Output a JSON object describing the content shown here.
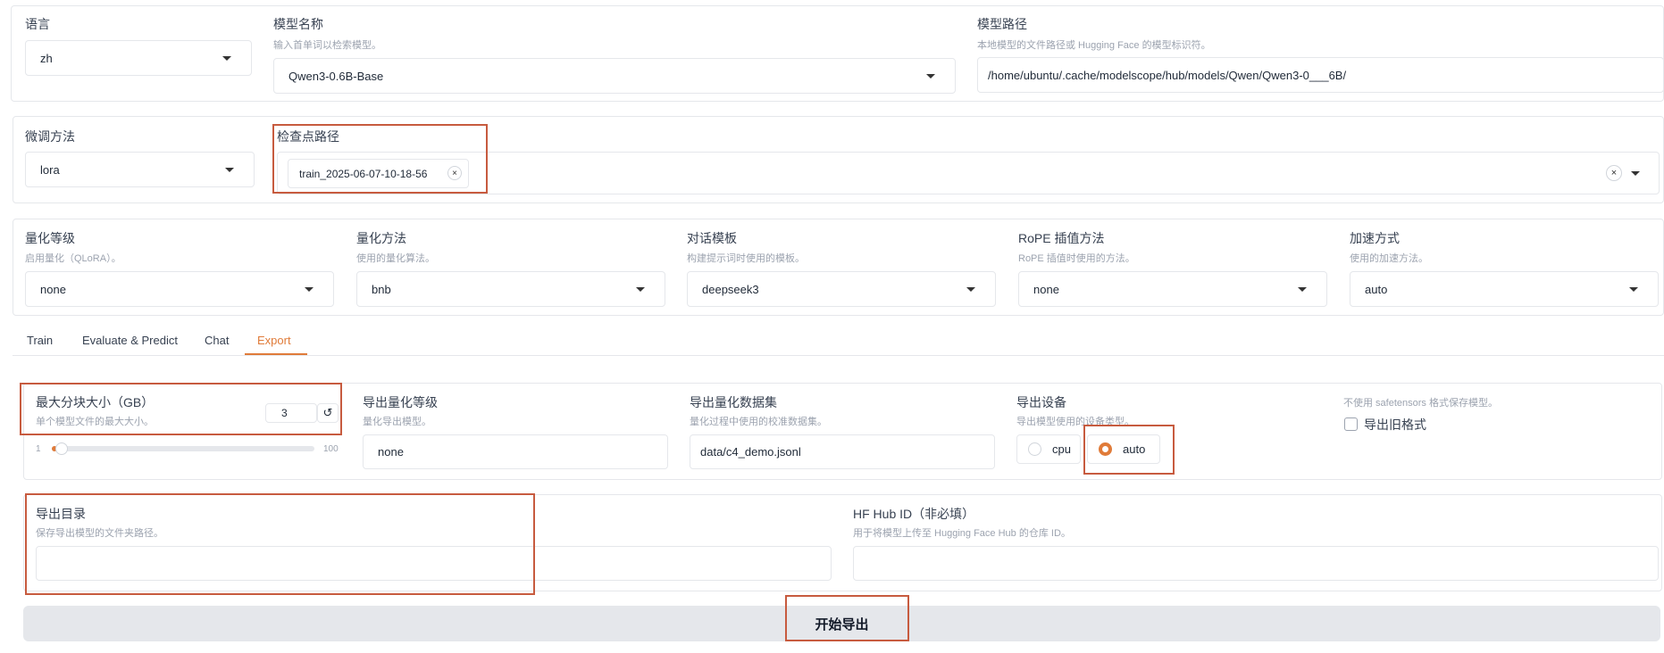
{
  "top": {
    "lang": {
      "label": "语言",
      "value": "zh"
    },
    "model_name": {
      "label": "模型名称",
      "hint": "输入首单词以检索模型。",
      "value": "Qwen3-0.6B-Base"
    },
    "model_path": {
      "label": "模型路径",
      "hint": "本地模型的文件路径或 Hugging Face 的模型标识符。",
      "value": "/home/ubuntu/.cache/modelscope/hub/models/Qwen/Qwen3-0___6B/"
    }
  },
  "finetune": {
    "method": {
      "label": "微调方法",
      "value": "lora"
    },
    "checkpoint": {
      "label": "检查点路径",
      "chip": "train_2025-06-07-10-18-56",
      "chip_close": "×",
      "clear": "×"
    }
  },
  "advanced": {
    "quant_level": {
      "label": "量化等级",
      "hint": "启用量化（QLoRA）。",
      "value": "none"
    },
    "quant_method": {
      "label": "量化方法",
      "hint": "使用的量化算法。",
      "value": "bnb"
    },
    "template": {
      "label": "对话模板",
      "hint": "构建提示词时使用的模板。",
      "value": "deepseek3"
    },
    "rope": {
      "label": "RoPE 插值方法",
      "hint": "RoPE 插值时使用的方法。",
      "value": "none"
    },
    "accel": {
      "label": "加速方式",
      "hint": "使用的加速方法。",
      "value": "auto"
    }
  },
  "tabs": [
    "Train",
    "Evaluate & Predict",
    "Chat",
    "Export"
  ],
  "export": {
    "shard_size": {
      "label": "最大分块大小（GB）",
      "hint": "单个模型文件的最大大小。",
      "value": "3",
      "reset_icon": "↺",
      "min": "1",
      "max": "100",
      "fraction": 0.02
    },
    "export_quant_bit": {
      "label": "导出量化等级",
      "hint": "量化导出模型。",
      "value": "none"
    },
    "export_quant_dataset": {
      "label": "导出量化数据集",
      "hint": "量化过程中使用的校准数据集。",
      "value": "data/c4_demo.jsonl"
    },
    "export_device": {
      "label": "导出设备",
      "hint": "导出模型使用的设备类型。",
      "options": [
        "cpu",
        "auto"
      ],
      "selected": "auto"
    },
    "legacy": {
      "hint": "不使用 safetensors 格式保存模型。",
      "label": "导出旧格式"
    },
    "export_dir": {
      "label": "导出目录",
      "hint": "保存导出模型的文件夹路径。",
      "value": ""
    },
    "hub_id": {
      "label": "HF Hub ID（非必填）",
      "hint": "用于将模型上传至 Hugging Face Hub 的仓库 ID。",
      "value": ""
    },
    "start_button": "开始导出"
  },
  "colors": {
    "accent": "#e07b39",
    "highlight": "#c75b3f"
  }
}
